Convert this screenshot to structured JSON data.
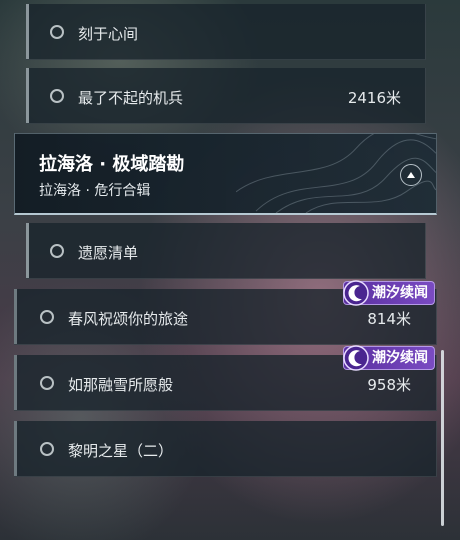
{
  "quests": {
    "item_1": {
      "label": "刻于心间"
    },
    "item_2": {
      "label": "最了不起的机兵",
      "distance": "2416米"
    },
    "group": {
      "title": "拉海洛 · 极域踏勘",
      "subtitle": "拉海洛 · 危行合辑"
    },
    "item_3": {
      "label": "遗愿清单"
    },
    "item_4": {
      "label": "春风祝颂你的旅途",
      "distance": "814米",
      "badge": "潮汐续闻"
    },
    "item_5": {
      "label": "如那融雪所愿般",
      "distance": "958米",
      "badge": "潮汐续闻"
    },
    "item_6": {
      "label": "黎明之星（二）"
    }
  },
  "colors": {
    "badge_purple": "#6a3db4",
    "card_bg": "#18242c",
    "text": "#e6eaec"
  },
  "icons": {
    "radio": "radio-circle-icon",
    "collapse": "chevron-up-icon",
    "badge": "tidal-moon-icon"
  }
}
